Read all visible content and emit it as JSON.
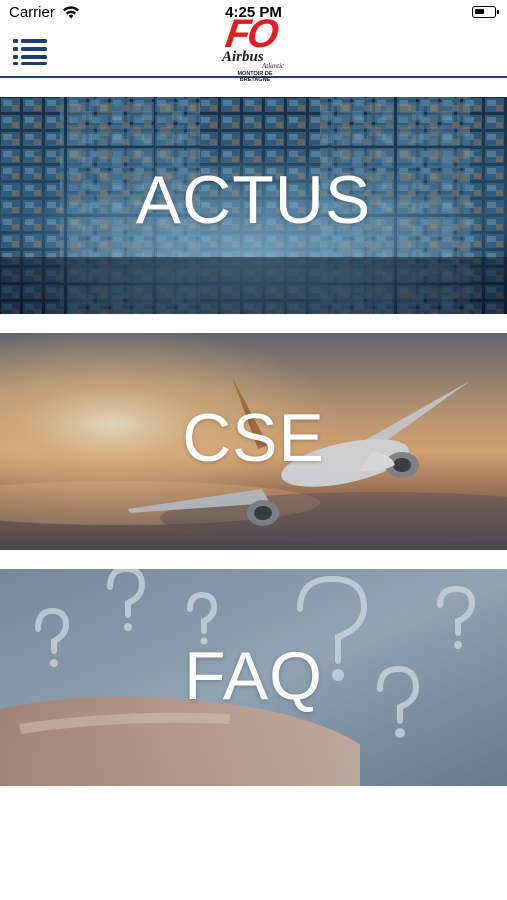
{
  "status_bar": {
    "carrier": "Carrier",
    "time": "4:25 PM"
  },
  "header": {
    "logo": {
      "mark": "FO",
      "brand": "Airbus",
      "tagline": "Atlantic",
      "location_line1": "MONTOIR DE",
      "location_line2": "BRETAGNE"
    },
    "menu_icon": "menu-list-icon"
  },
  "tiles": [
    {
      "label": "ACTUS",
      "image": "wall-of-screens"
    },
    {
      "label": "CSE",
      "image": "airplane-sunset"
    },
    {
      "label": "FAQ",
      "image": "question-marks-hand"
    }
  ],
  "colors": {
    "logo_red": "#e31c23",
    "nav_blue": "#23406f",
    "tile_text": "#ffffff"
  }
}
